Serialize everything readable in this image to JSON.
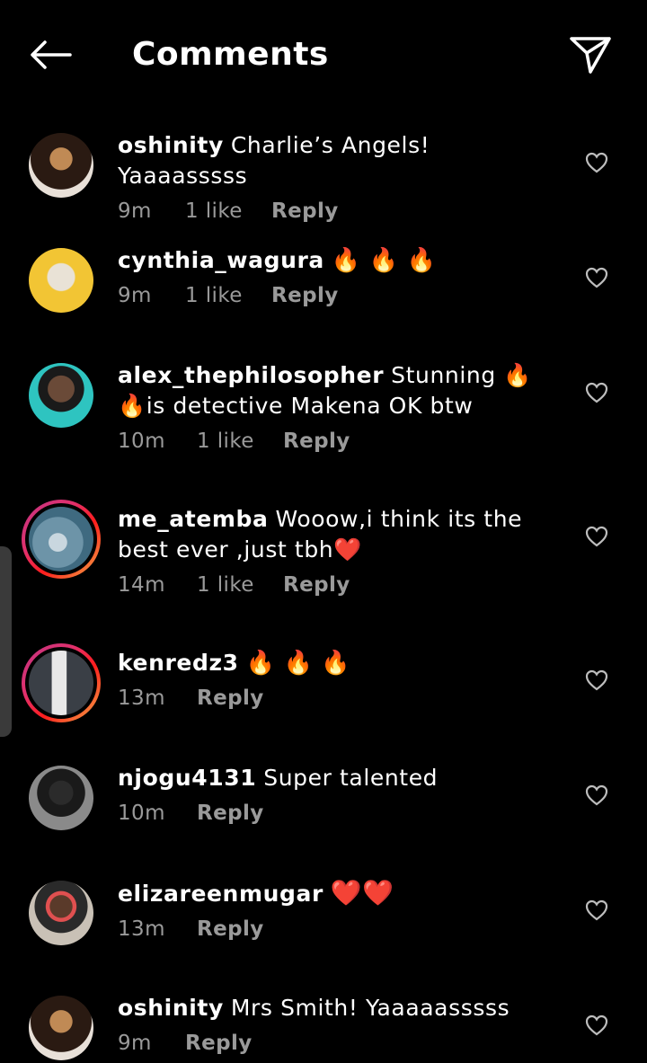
{
  "header": {
    "title": "Comments"
  },
  "comments": [
    {
      "username": "oshinity",
      "text": "Charlie’s Angels! Yaaaasssss",
      "time": "9m",
      "likes": "1 like",
      "reply": "Reply",
      "avatar_color": "#3a2a20",
      "story_ring": false
    },
    {
      "username": "cynthia_wagura",
      "text": "🔥 🔥 🔥",
      "time": "9m",
      "likes": "1 like",
      "reply": "Reply",
      "avatar_color": "#f2c534",
      "story_ring": false
    },
    {
      "username": "alex_thephilosopher",
      "text": "Stunning 🔥 🔥is detective Makena OK btw",
      "time": "10m",
      "likes": "1 like",
      "reply": "Reply",
      "avatar_color": "#2ec4c0",
      "story_ring": false
    },
    {
      "username": "me_atemba",
      "text": "Wooow,i think its the best ever ,just tbh❤️",
      "time": "14m",
      "likes": "1 like",
      "reply": "Reply",
      "avatar_color": "#4f7d95",
      "story_ring": true
    },
    {
      "username": "kenredz3",
      "text": "🔥 🔥 🔥",
      "time": "13m",
      "likes": "",
      "reply": "Reply",
      "avatar_color": "#5b6470",
      "story_ring": true
    },
    {
      "username": "njogu4131",
      "text": "Super talented",
      "time": "10m",
      "likes": "",
      "reply": "Reply",
      "avatar_color": "#6d6d6d",
      "story_ring": false
    },
    {
      "username": "elizareenmugar",
      "text": "❤️❤️",
      "time": "13m",
      "likes": "",
      "reply": "Reply",
      "avatar_color": "#b7a99b",
      "story_ring": false
    },
    {
      "username": "oshinity",
      "text": "Mrs Smith! Yaaaaasssss",
      "time": "9m",
      "likes": "",
      "reply": "Reply",
      "avatar_color": "#3a2a20",
      "story_ring": false
    }
  ]
}
